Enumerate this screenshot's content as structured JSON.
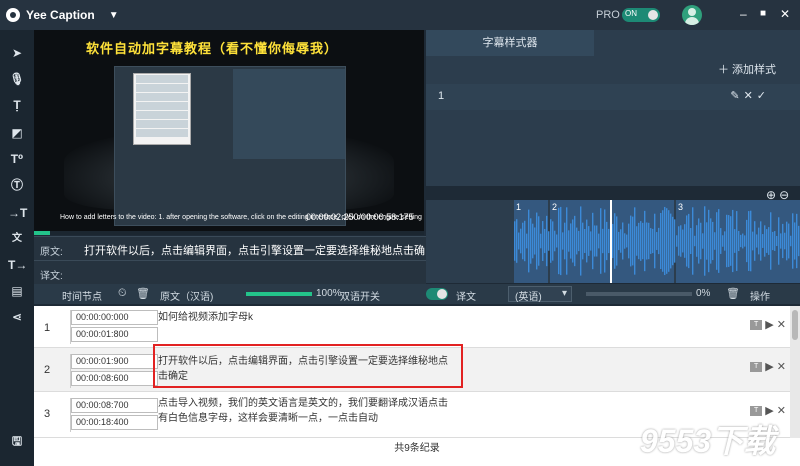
{
  "titlebar": {
    "app_title": "Yee Caption",
    "pro_label": "PRO",
    "pro_toggle_label": "ON",
    "min_glyph": "–",
    "max_glyph": "■",
    "close_glyph": "✕"
  },
  "video": {
    "overlay_title": "软件自动加字幕教程（看不懂你侮辱我）",
    "subtitle_line": "How to add letters to the video: 1. after opening the software, click on the editing interface, click on the engine setting",
    "timecode": "00:00:02.250/00:00:58.175",
    "progress": 0.04
  },
  "style_panel": {
    "tab_label": "字幕样式器",
    "add_style": "添加样式",
    "row_number": "1"
  },
  "waveform": {
    "segments": [
      "1",
      "2",
      "3"
    ]
  },
  "source_bar": {
    "label": "原文:",
    "text": "打开软件以后，点击编辑界面，点击引擎设置一定要选择维秘地点击确定"
  },
  "translation_bar": {
    "label": "译文:"
  },
  "table_header": {
    "time_label": "时间节点",
    "source_label": "原文（汉语)",
    "source_percent": "100%",
    "bilingual_label": "双语开关",
    "translation_label": "译文",
    "language_select": "(英语)",
    "translation_percent": "0%",
    "ops_label": "操作",
    "source_progress": 1.0,
    "translation_progress": 0.0
  },
  "rows": [
    {
      "num": "1",
      "start": "00:00:00:000",
      "end": "00:00:01:800",
      "text": "如何给视频添加字母k"
    },
    {
      "num": "2",
      "start": "00:00:01:900",
      "end": "00:00:08:600",
      "text": "打开软件以后，点击编辑界面，点击引擎设置一定要选择维秘地点击确定"
    },
    {
      "num": "3",
      "start": "00:00:08:700",
      "end": "00:00:18:400",
      "text": "点击导入视频，我们的英文语言是英文的，我们要翻译成汉语点击有白色信息字母，这样会要清晰一点，一点击自动"
    }
  ],
  "footer": {
    "record_count": "共9条纪录"
  },
  "watermark": "9553下载"
}
